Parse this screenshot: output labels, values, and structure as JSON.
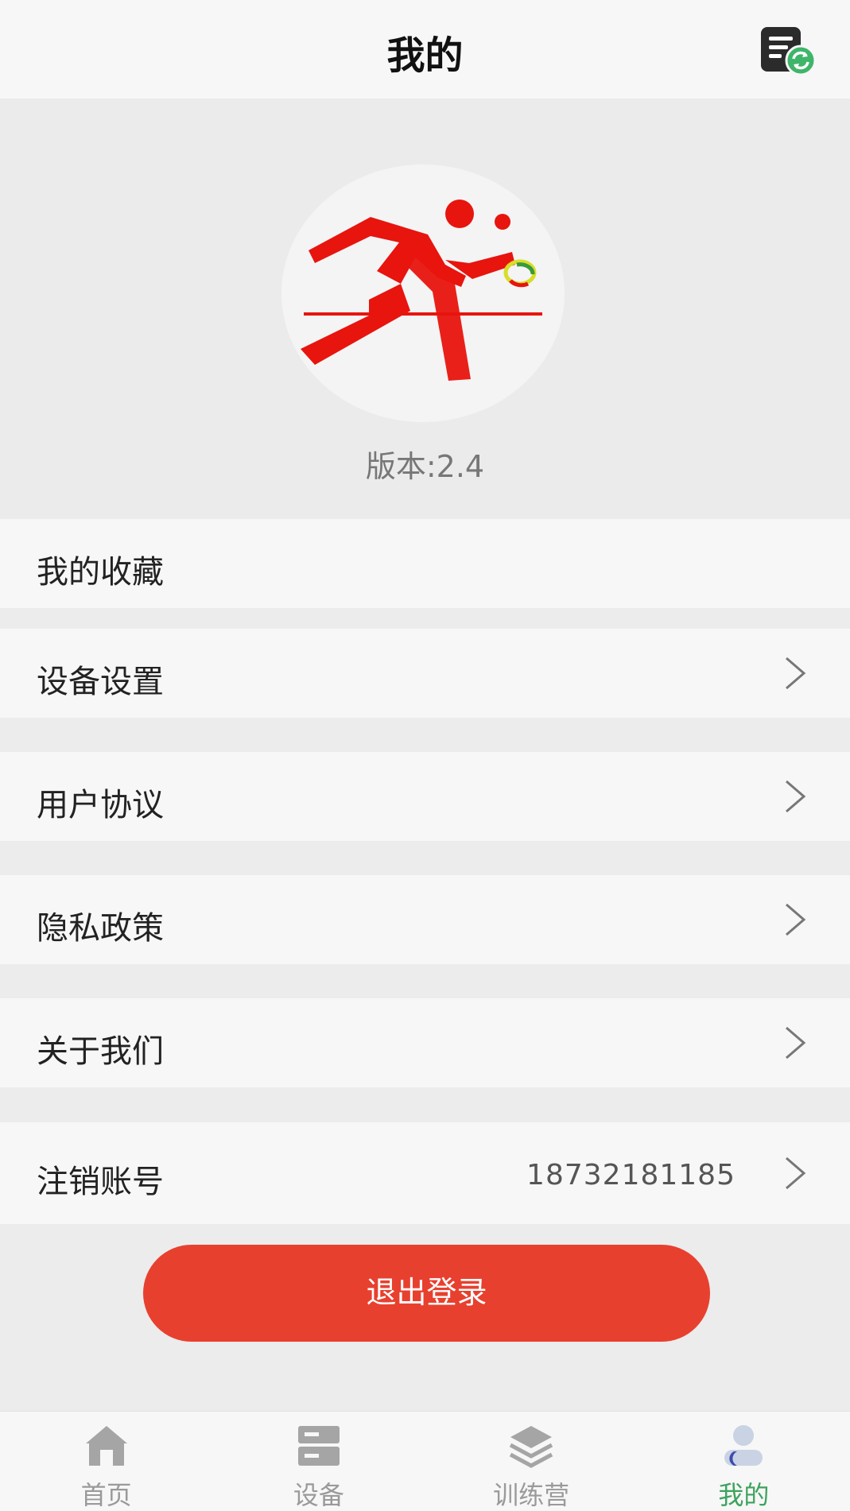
{
  "header": {
    "title": "我的",
    "icon": "sync-list-icon"
  },
  "profile": {
    "logo": "table-tennis-player-logo",
    "version": "版本:2.4"
  },
  "menu": [
    {
      "label": "我的收藏",
      "value": "",
      "chevron": false
    },
    {
      "label": "设备设置",
      "value": "",
      "chevron": true
    },
    {
      "label": "用户协议",
      "value": "",
      "chevron": true
    },
    {
      "label": "隐私政策",
      "value": "",
      "chevron": true
    },
    {
      "label": "关于我们",
      "value": "",
      "chevron": true
    },
    {
      "label": "注销账号",
      "value": "18732181185",
      "chevron": true
    }
  ],
  "logout": {
    "label": "退出登录",
    "color": "#e8402f"
  },
  "tabs": [
    {
      "label": "首页",
      "icon": "home-icon",
      "active": false
    },
    {
      "label": "设备",
      "icon": "device-icon",
      "active": false
    },
    {
      "label": "训练营",
      "icon": "layers-icon",
      "active": false
    },
    {
      "label": "我的",
      "icon": "profile-icon",
      "active": true
    }
  ],
  "colors": {
    "accent": "#3da35d",
    "logout": "#e8402f",
    "logo_red": "#e8140e"
  }
}
